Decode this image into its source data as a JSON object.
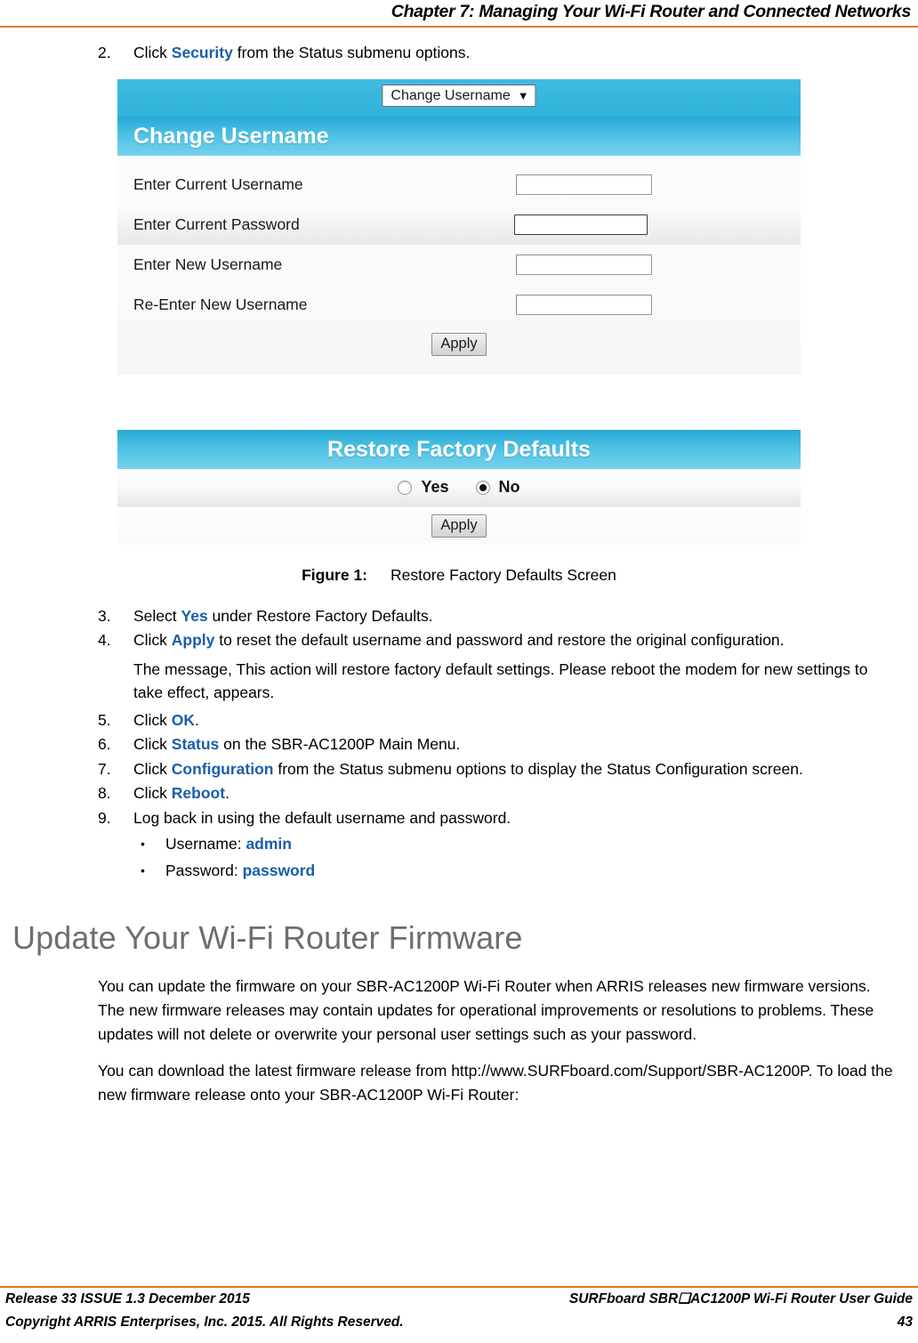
{
  "header": {
    "chapter_title": "Chapter 7: Managing Your Wi-Fi Router and Connected Networks",
    "rule_color": "#e07b29"
  },
  "step2": {
    "number": "2.",
    "text_before": "Click ",
    "keyword": "Security",
    "text_after": " from the Status submenu options."
  },
  "figure": {
    "panel1": {
      "dropdown": {
        "selected": "Change Username",
        "caret": "⌄",
        "options": [
          "Change Username"
        ]
      },
      "title": "Change Username",
      "rows": [
        {
          "label": "Enter Current Username",
          "value": ""
        },
        {
          "label": "Enter Current Password",
          "value": ""
        },
        {
          "label": "Enter New Username",
          "value": ""
        },
        {
          "label": "Re-Enter New Username",
          "value": ""
        }
      ],
      "apply_label": "Apply"
    },
    "panel2": {
      "title": "Restore Factory Defaults",
      "radios": [
        {
          "label": "Yes",
          "selected": false
        },
        {
          "label": "No",
          "selected": true
        }
      ],
      "apply_label": "Apply"
    },
    "caption_label": "Figure 1:",
    "caption_text": "Restore Factory Defaults Screen",
    "accent_blue": "#28a9d6",
    "topbar_blue": "#36b6dd"
  },
  "steps": [
    {
      "number": "3.",
      "before": "Select ",
      "keyword": "Yes",
      "after": " under Restore Factory Defaults."
    },
    {
      "number": "4.",
      "before": "Click ",
      "keyword": "Apply",
      "after": " to reset the default username and password and restore the original configuration."
    },
    {
      "number": "5.",
      "before": "Click ",
      "keyword": "OK",
      "after": "."
    },
    {
      "number": "6.",
      "before": "Click ",
      "keyword": "Status",
      "after": " on the SBR-AC1200P Main Menu."
    },
    {
      "number": "7.",
      "before": "Click ",
      "keyword": "Configuration",
      "after": " from the Status submenu options to display the Status Configuration screen."
    },
    {
      "number": "8.",
      "before": "Click ",
      "keyword": "Reboot",
      "after": "."
    },
    {
      "number": "9.",
      "before": "Log back in using the default username and password.",
      "keyword": "",
      "after": ""
    }
  ],
  "step4_note": "The message, This action will restore factory default settings. Please reboot the modem for new settings to take effect, appears.",
  "credentials": [
    {
      "bullet": "•",
      "label": "Username: ",
      "value": "admin"
    },
    {
      "bullet": "•",
      "label": "Password: ",
      "value": "password"
    }
  ],
  "section": {
    "heading": "Update Your Wi-Fi Router Firmware",
    "paragraph1": "You can update the firmware on your SBR-AC1200P Wi-Fi Router when ARRIS releases new firmware versions. The new firmware releases may contain updates for operational improvements or resolutions to problems. These updates will not delete or overwrite your personal user settings such as your password.",
    "paragraph2": "You can download the latest firmware release from http://www.SURFboard.com/Support/SBR-AC1200P. To load the new firmware release onto your SBR-AC1200P Wi-Fi Router:"
  },
  "footer": {
    "left_line1": "Release 33 ISSUE 1.3    December 2015",
    "left_line2": "Copyright ARRIS Enterprises, Inc. 2015. All Rights Reserved.",
    "right_line1": "SURFboard SBR❑AC1200P Wi-Fi Router User Guide",
    "right_line2": "43"
  }
}
